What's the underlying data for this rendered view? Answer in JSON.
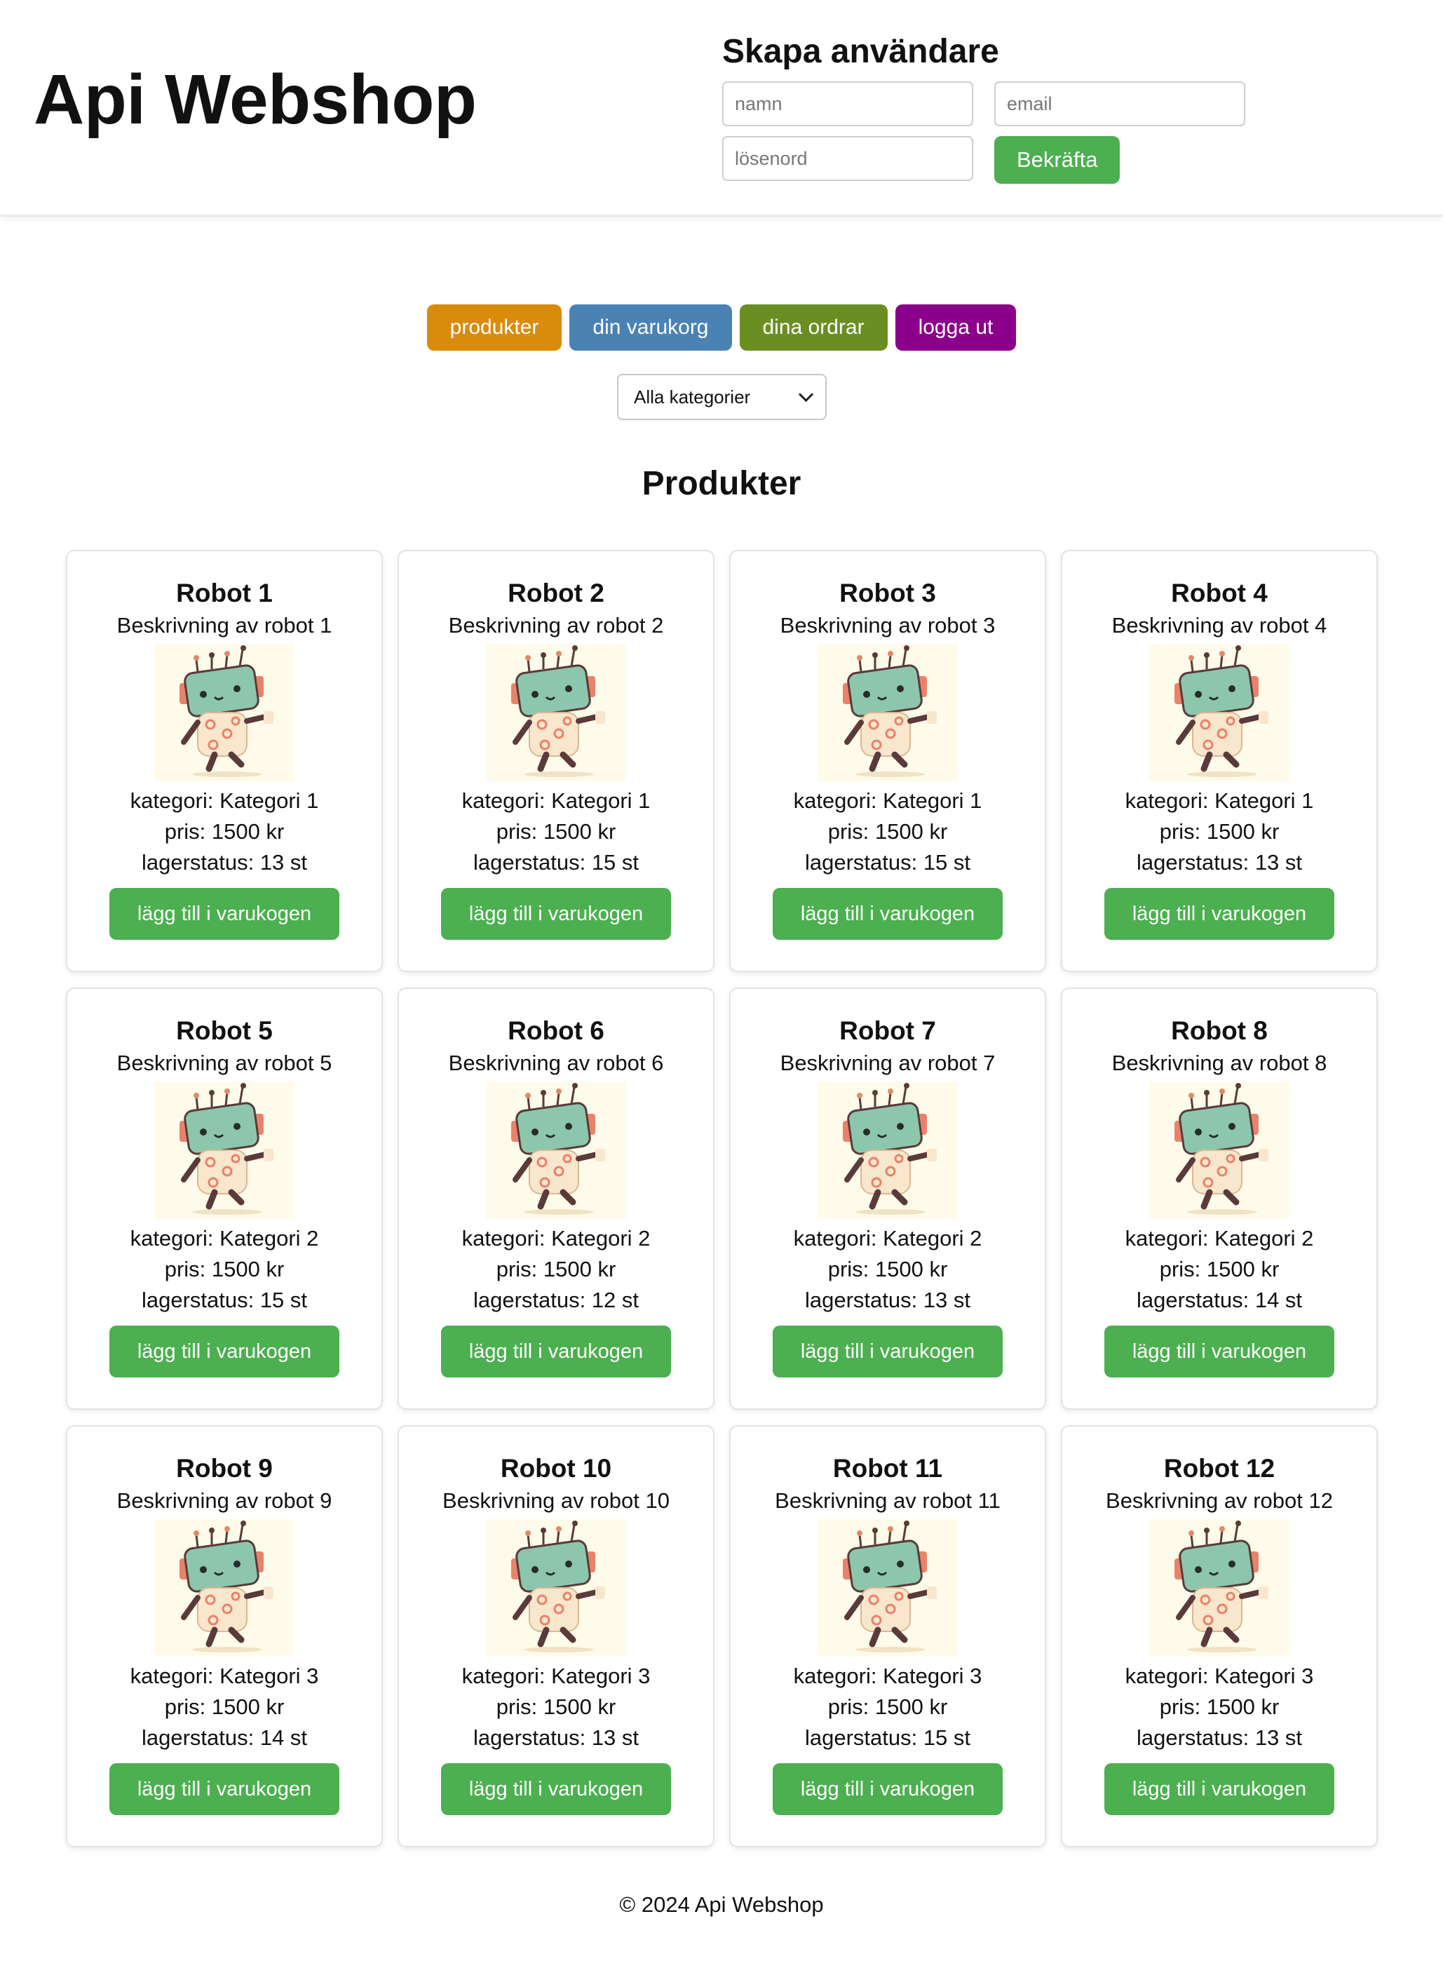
{
  "header": {
    "site_title": "Api Webshop",
    "signup": {
      "title": "Skapa användare",
      "name_placeholder": "namn",
      "email_placeholder": "email",
      "password_placeholder": "lösenord",
      "confirm_label": "Bekräfta"
    }
  },
  "nav": {
    "items": [
      {
        "label": "produkter",
        "color": "#d98b0b"
      },
      {
        "label": "din varukorg",
        "color": "#4a82b4"
      },
      {
        "label": "dina ordrar",
        "color": "#6b8e23"
      },
      {
        "label": "logga ut",
        "color": "#8b008b"
      }
    ]
  },
  "filter": {
    "selected": "Alla kategorier"
  },
  "products_title": "Produkter",
  "products": [
    {
      "name": "Robot 1",
      "description": "Beskrivning av robot 1",
      "category": "kategori: Kategori 1",
      "price": "pris: 1500 kr",
      "stock": "lagerstatus: 13 st",
      "button": "lägg till i varukogen"
    },
    {
      "name": "Robot 2",
      "description": "Beskrivning av robot 2",
      "category": "kategori: Kategori 1",
      "price": "pris: 1500 kr",
      "stock": "lagerstatus: 15 st",
      "button": "lägg till i varukogen"
    },
    {
      "name": "Robot 3",
      "description": "Beskrivning av robot 3",
      "category": "kategori: Kategori 1",
      "price": "pris: 1500 kr",
      "stock": "lagerstatus: 15 st",
      "button": "lägg till i varukogen"
    },
    {
      "name": "Robot 4",
      "description": "Beskrivning av robot 4",
      "category": "kategori: Kategori 1",
      "price": "pris: 1500 kr",
      "stock": "lagerstatus: 13 st",
      "button": "lägg till i varukogen"
    },
    {
      "name": "Robot 5",
      "description": "Beskrivning av robot 5",
      "category": "kategori: Kategori 2",
      "price": "pris: 1500 kr",
      "stock": "lagerstatus: 15 st",
      "button": "lägg till i varukogen"
    },
    {
      "name": "Robot 6",
      "description": "Beskrivning av robot 6",
      "category": "kategori: Kategori 2",
      "price": "pris: 1500 kr",
      "stock": "lagerstatus: 12 st",
      "button": "lägg till i varukogen"
    },
    {
      "name": "Robot 7",
      "description": "Beskrivning av robot 7",
      "category": "kategori: Kategori 2",
      "price": "pris: 1500 kr",
      "stock": "lagerstatus: 13 st",
      "button": "lägg till i varukogen"
    },
    {
      "name": "Robot 8",
      "description": "Beskrivning av robot 8",
      "category": "kategori: Kategori 2",
      "price": "pris: 1500 kr",
      "stock": "lagerstatus: 14 st",
      "button": "lägg till i varukogen"
    },
    {
      "name": "Robot 9",
      "description": "Beskrivning av robot 9",
      "category": "kategori: Kategori 3",
      "price": "pris: 1500 kr",
      "stock": "lagerstatus: 14 st",
      "button": "lägg till i varukogen"
    },
    {
      "name": "Robot 10",
      "description": "Beskrivning av robot 10",
      "category": "kategori: Kategori 3",
      "price": "pris: 1500 kr",
      "stock": "lagerstatus: 13 st",
      "button": "lägg till i varukogen"
    },
    {
      "name": "Robot 11",
      "description": "Beskrivning av robot 11",
      "category": "kategori: Kategori 3",
      "price": "pris: 1500 kr",
      "stock": "lagerstatus: 15 st",
      "button": "lägg till i varukogen"
    },
    {
      "name": "Robot 12",
      "description": "Beskrivning av robot 12",
      "category": "kategori: Kategori 3",
      "price": "pris: 1500 kr",
      "stock": "lagerstatus: 13 st",
      "button": "lägg till i varukogen"
    }
  ],
  "footer": {
    "text": "© 2024 Api Webshop"
  },
  "colors": {
    "accent_green": "#4caf50",
    "image_bg": "#fefbea"
  }
}
